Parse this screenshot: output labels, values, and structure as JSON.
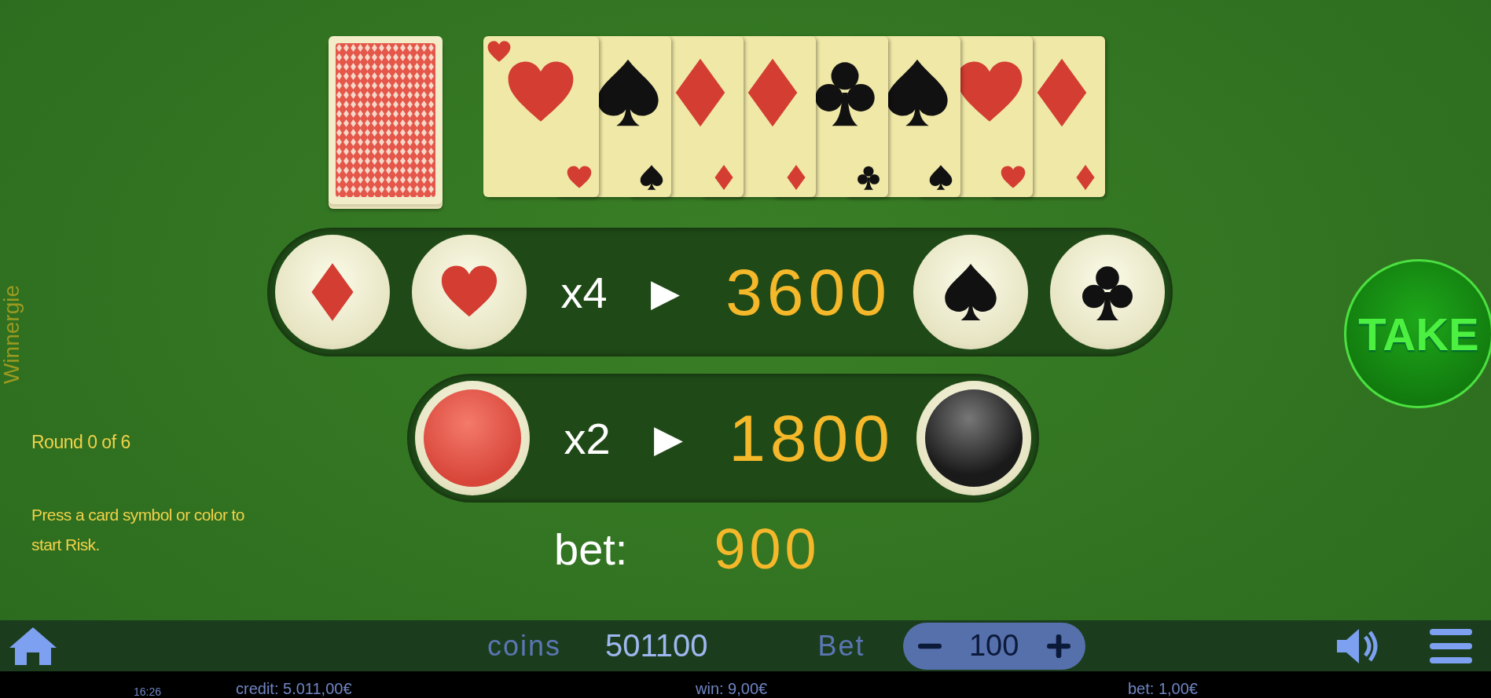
{
  "provider": "Winnergie",
  "round": "Round 0  of 6",
  "hint": "Press a card symbol or color to start Risk.",
  "cards": [
    {
      "kind": "hearts"
    },
    {
      "kind": "spades"
    },
    {
      "kind": "diamonds"
    },
    {
      "kind": "diamonds"
    },
    {
      "kind": "clubs"
    },
    {
      "kind": "spades"
    },
    {
      "kind": "hearts"
    },
    {
      "kind": "diamonds"
    }
  ],
  "suit_row": {
    "left": [
      {
        "kind": "diamonds"
      },
      {
        "kind": "hearts"
      }
    ],
    "multiplier": "x4",
    "arrow": "▶",
    "amount": "3600",
    "right": [
      {
        "kind": "spades"
      },
      {
        "kind": "clubs"
      }
    ]
  },
  "color_row": {
    "left": [
      {
        "kind": "red"
      }
    ],
    "multiplier": "x2",
    "arrow": "▶",
    "amount": "1800",
    "right": [
      {
        "kind": "black"
      }
    ]
  },
  "bet_label": "bet:",
  "bet_amount": "900",
  "take_button": "TAKE",
  "bottom_bar": {
    "coins_label": "coins",
    "coins": "501100",
    "bet_label": "Bet",
    "bet": "100"
  },
  "status_bar": {
    "time": "16:26",
    "credit": "credit: 5.011,00€",
    "win": "win: 9,00€",
    "bet": "bet: 1,00€"
  }
}
